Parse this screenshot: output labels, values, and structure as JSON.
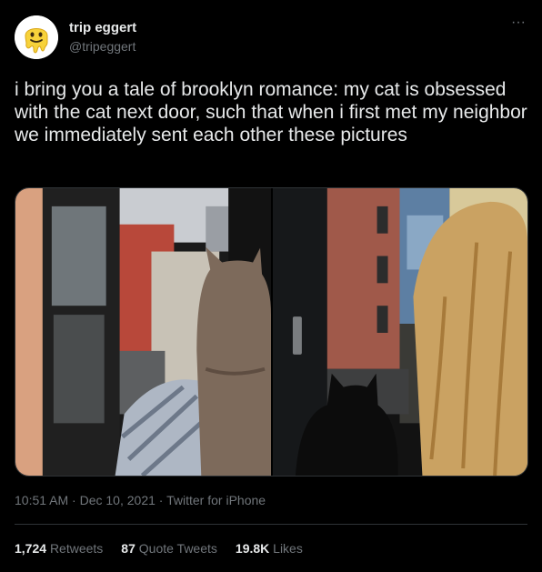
{
  "author": {
    "display_name": "trip eggert",
    "handle": "@tripeggert",
    "avatar_icon": "melting-face-emoji-icon"
  },
  "tweet": {
    "text": "i bring you a tale of brooklyn romance: my cat is obsessed with the cat next door, such that when i first met my neighbor we immediately sent each other these pictures",
    "time": "10:51 AM",
    "date": "Dec 10, 2021",
    "separator": "·",
    "source": "Twitter for iPhone"
  },
  "media": {
    "photos": [
      {
        "description_icon": "grey-cat-at-window-photo"
      },
      {
        "description_icon": "black-cat-at-window-photo"
      }
    ]
  },
  "stats": {
    "retweets_count": "1,724",
    "retweets_label": "Retweets",
    "quotes_count": "87",
    "quotes_label": "Quote Tweets",
    "likes_count": "19.8K",
    "likes_label": "Likes"
  },
  "more_icon": "more-horizontal-icon",
  "colors": {
    "background": "#000000",
    "text": "#e7e9ea",
    "secondary": "#71767b",
    "divider": "#2f3336"
  }
}
